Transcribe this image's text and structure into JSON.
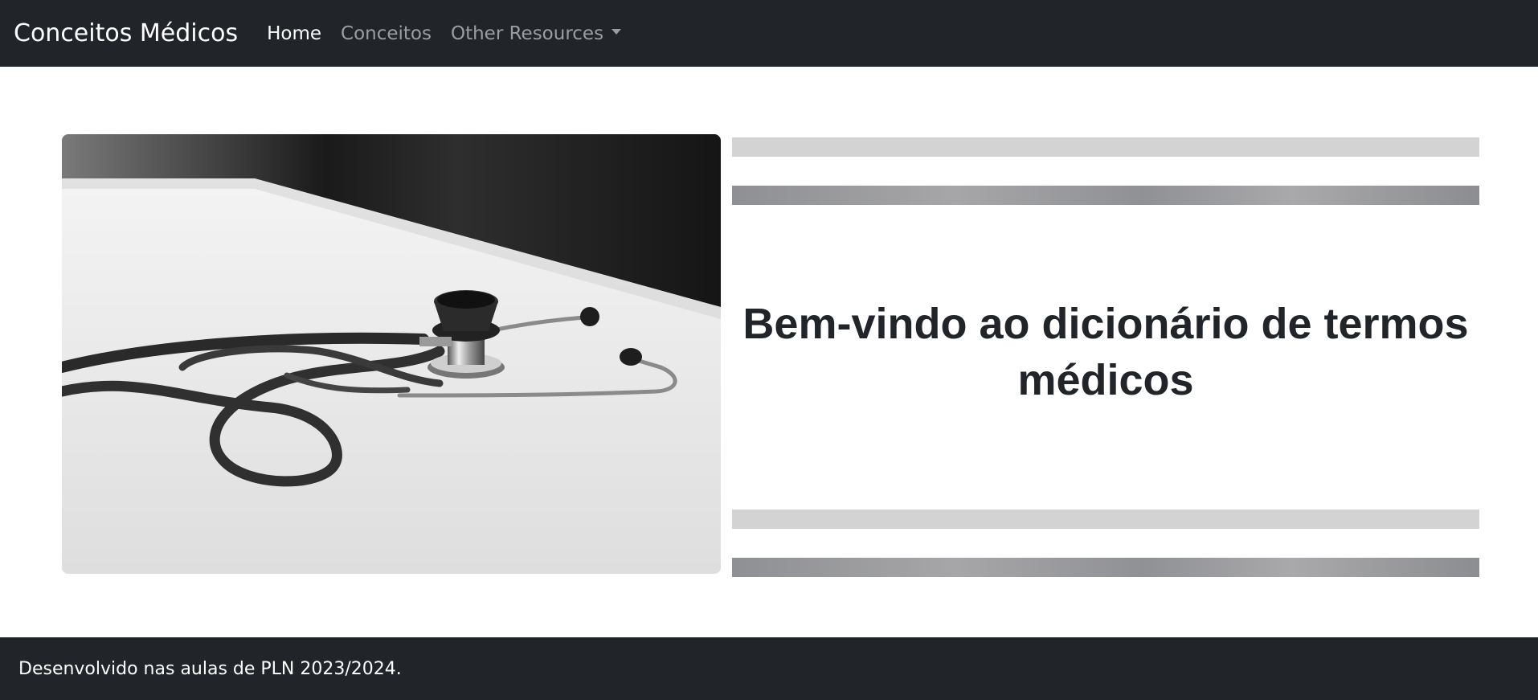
{
  "navbar": {
    "brand": "Conceitos Médicos",
    "links": [
      {
        "label": "Home",
        "active": true
      },
      {
        "label": "Conceitos",
        "active": false
      },
      {
        "label": "Other Resources",
        "active": false,
        "dropdown": true
      }
    ]
  },
  "hero": {
    "image_icon": "stethoscope-photo",
    "title": "Bem-vindo ao dicionário de termos médicos"
  },
  "footer": {
    "text": "Desenvolvido nas aulas de PLN 2023/2024."
  },
  "colors": {
    "navbar_bg": "#212529",
    "footer_bg": "#212529",
    "bar_light": "#d3d3d3",
    "bar_dark": "#98999c",
    "text": "#212529"
  }
}
